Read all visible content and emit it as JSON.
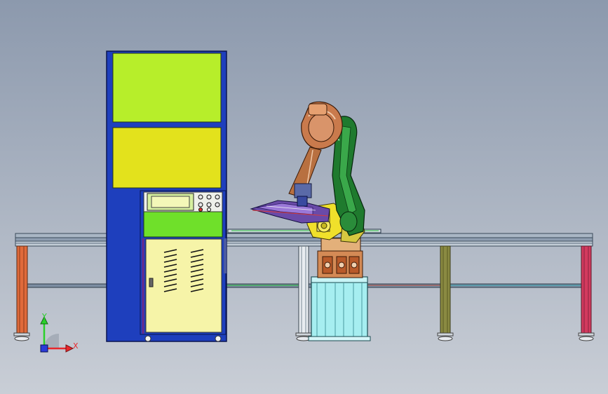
{
  "viewport": {
    "background_top": "#8c99ad",
    "background_bottom": "#c9ced6"
  },
  "triad": {
    "x_label": "X",
    "y_label": "Y",
    "x_color": "#e8272c",
    "y_color": "#2bd12b",
    "z_color": "#2a3ad8"
  },
  "colors": {
    "cabinet_frame": "#1e3fbd",
    "upper_panel": "#b7ee2a",
    "middle_panel": "#e3e21c",
    "control_band": "#6fe02a",
    "lower_door": "#f6f4a8",
    "robot_orange": "#d48a55",
    "robot_green": "#1f7a2e",
    "robot_yellow": "#f0e02b",
    "pedestal": "#a6eef0",
    "rail": "#7a8ea0"
  },
  "icons": [
    "coordinate-triad-icon"
  ]
}
